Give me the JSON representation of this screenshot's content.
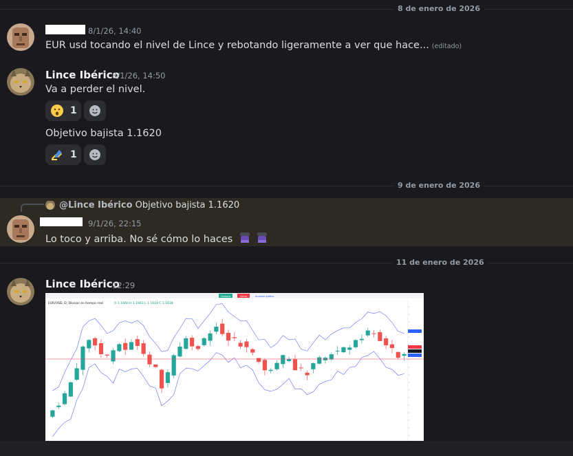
{
  "dividers": [
    {
      "label": "8 de enero de 2026"
    },
    {
      "label": "9 de enero de 2026"
    },
    {
      "label": "11 de enero de 2026"
    }
  ],
  "messages": {
    "m1": {
      "timestamp": "8/1/26, 14:40",
      "text": "EUR usd tocando el nivel de Lince y rebotando ligeramente a ver que hace...",
      "edited": "(editado)"
    },
    "m2": {
      "author": "Lince Ibérico",
      "timestamp": "8/1/26, 14:50",
      "text": "Va a perder el nivel.",
      "reaction": {
        "emoji": "hushed-face",
        "count": "1"
      }
    },
    "m3": {
      "text": "Objetivo bajista 1.1620",
      "reaction": {
        "emoji": "writing-hand",
        "count": "1"
      }
    },
    "m4": {
      "reply_author": "@Lince Ibérico",
      "reply_text": "Objetivo bajista 1.1620",
      "timestamp": "9/1/26, 22:15",
      "text": "Lo toco y arriba. No sé cómo lo haces"
    },
    "m5": {
      "author": "Lince Ibérico",
      "timestamp": "12:29"
    }
  },
  "chart": {
    "title": "EUR/USD, D, Divisas en tiempo real",
    "ohlc": "O 1.1660  H 1.1663  L 1.1618  C 1.1638",
    "buy_label": "Compra",
    "sell_label": "Venta",
    "analyze_label": "Analizar gráfico",
    "colors": {
      "up": "#26a69a",
      "down": "#ef5350",
      "band": "#5b6bff"
    }
  }
}
